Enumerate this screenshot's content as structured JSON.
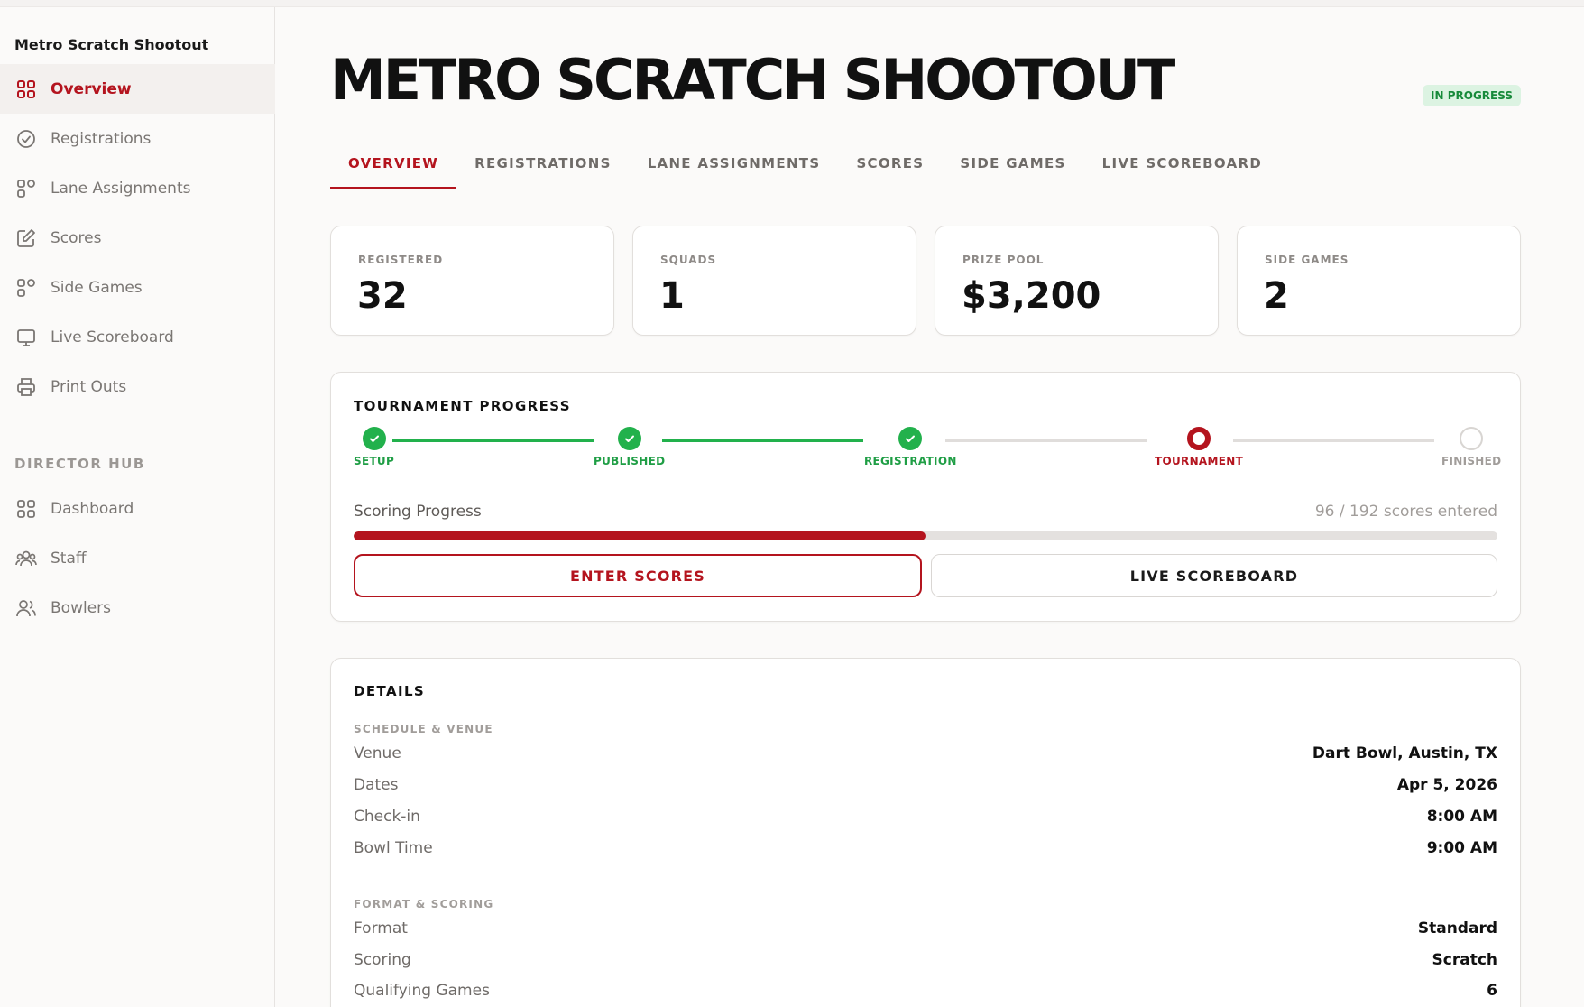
{
  "sidebar": {
    "title": "Metro Scratch Shootout",
    "items": [
      {
        "label": "Overview",
        "icon": "grid-icon"
      },
      {
        "label": "Registrations",
        "icon": "check-circle-icon"
      },
      {
        "label": "Lane Assignments",
        "icon": "lanes-icon"
      },
      {
        "label": "Scores",
        "icon": "edit-icon"
      },
      {
        "label": "Side Games",
        "icon": "side-games-icon"
      },
      {
        "label": "Live Scoreboard",
        "icon": "monitor-icon"
      },
      {
        "label": "Print Outs",
        "icon": "printer-icon"
      }
    ],
    "section_label": "DIRECTOR HUB",
    "hub_items": [
      {
        "label": "Dashboard",
        "icon": "dashboard-icon"
      },
      {
        "label": "Staff",
        "icon": "staff-icon"
      },
      {
        "label": "Bowlers",
        "icon": "bowlers-icon"
      }
    ]
  },
  "header": {
    "title": "METRO SCRATCH SHOOTOUT",
    "status": "IN PROGRESS"
  },
  "tabs": [
    "OVERVIEW",
    "REGISTRATIONS",
    "LANE ASSIGNMENTS",
    "SCORES",
    "SIDE GAMES",
    "LIVE SCOREBOARD"
  ],
  "stats": [
    {
      "label": "REGISTERED",
      "value": "32"
    },
    {
      "label": "SQUADS",
      "value": "1"
    },
    {
      "label": "PRIZE POOL",
      "value": "$3,200"
    },
    {
      "label": "SIDE GAMES",
      "value": "2"
    }
  ],
  "progress": {
    "title": "TOURNAMENT PROGRESS",
    "steps": [
      {
        "label": "SETUP",
        "state": "done"
      },
      {
        "label": "PUBLISHED",
        "state": "done"
      },
      {
        "label": "REGISTRATION",
        "state": "done"
      },
      {
        "label": "TOURNAMENT",
        "state": "current"
      },
      {
        "label": "FINISHED",
        "state": "todo"
      }
    ],
    "scoring_label": "Scoring Progress",
    "scoring_count": "96 / 192 scores entered",
    "scores_entered": 96,
    "scores_total": 192,
    "enter_scores_label": "ENTER SCORES",
    "live_scoreboard_label": "LIVE SCOREBOARD"
  },
  "details": {
    "title": "DETAILS",
    "schedule_heading": "SCHEDULE & VENUE",
    "schedule": [
      {
        "key": "Venue",
        "value": "Dart Bowl, Austin, TX"
      },
      {
        "key": "Dates",
        "value": "Apr 5, 2026"
      },
      {
        "key": "Check-in",
        "value": "8:00 AM"
      },
      {
        "key": "Bowl Time",
        "value": "9:00 AM"
      }
    ],
    "format_heading": "FORMAT & SCORING",
    "format": [
      {
        "key": "Format",
        "value": "Standard"
      },
      {
        "key": "Scoring",
        "value": "Scratch"
      },
      {
        "key": "Qualifying Games",
        "value": "6"
      }
    ]
  },
  "colors": {
    "accent": "#b4141e",
    "success": "#22b14c",
    "background": "#fbfaf9"
  }
}
